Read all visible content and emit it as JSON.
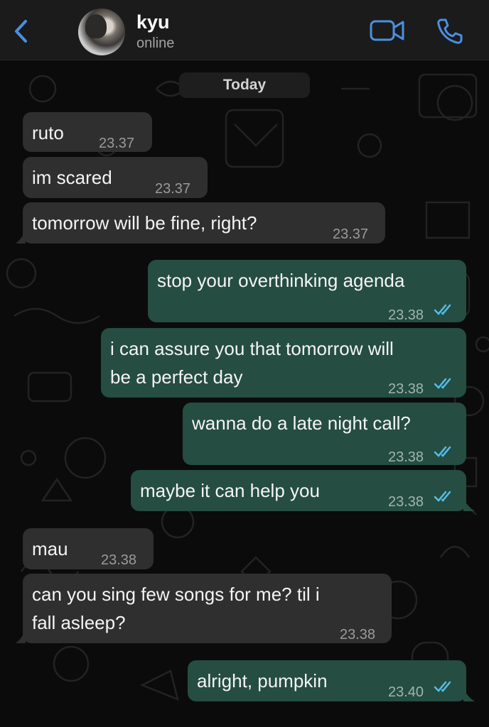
{
  "header": {
    "contact_name": "kyu",
    "status": "online"
  },
  "date_label": "Today",
  "messages": [
    {
      "dir": "in",
      "text": "ruto",
      "time": "23.37"
    },
    {
      "dir": "in",
      "text": "im scared",
      "time": "23.37"
    },
    {
      "dir": "in",
      "text": "tomorrow will be fine, right?",
      "time": "23.37"
    },
    {
      "dir": "out",
      "text": "stop your overthinking agenda",
      "time": "23.38",
      "status": "read"
    },
    {
      "dir": "out",
      "lines": [
        "i can assure you that tomorrow will",
        "be a perfect day"
      ],
      "time": "23.38",
      "status": "read"
    },
    {
      "dir": "out",
      "text": "wanna do a late night call?",
      "time": "23.38",
      "status": "read"
    },
    {
      "dir": "out",
      "text": "maybe it can help you",
      "time": "23.38",
      "status": "read"
    },
    {
      "dir": "in",
      "text": "mau",
      "time": "23.38"
    },
    {
      "dir": "in",
      "lines": [
        "can you sing few songs for me? til i",
        "fall asleep?"
      ],
      "time": "23.38"
    },
    {
      "dir": "out",
      "text": "alright, pumpkin",
      "time": "23.40",
      "status": "read"
    }
  ],
  "colors": {
    "accent": "#4a90e2",
    "incoming_bubble": "#2f2f2f",
    "outgoing_bubble": "#254d41",
    "read_ticks": "#53bdeb"
  },
  "icons": [
    "back-chevron-icon",
    "video-call-icon",
    "voice-call-icon",
    "read-receipt-icon"
  ]
}
